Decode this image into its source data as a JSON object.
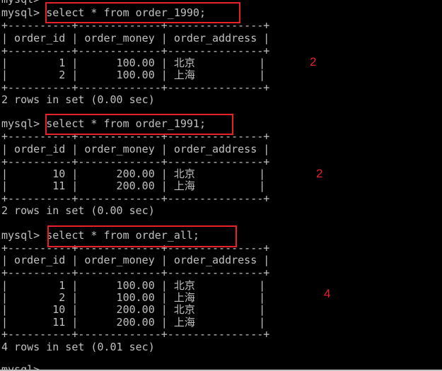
{
  "terminal": {
    "top_partial": "mysql>",
    "bottom_partial": "mysql>",
    "blocks": [
      {
        "prompt": "mysql> ",
        "command": "select * from order_1990;",
        "border": "+----------+-------------+---------------+",
        "header": "| order_id | order_money | order_address |",
        "rows": [
          "|        1 |      100.00 | 北京          |",
          "|        2 |      100.00 | 上海          |"
        ],
        "result": "2 rows in set (0.00 sec)",
        "annotation": "2"
      },
      {
        "prompt": "mysql> ",
        "command": "select * from order_1991;",
        "border": "+----------+-------------+---------------+",
        "header": "| order_id | order_money | order_address |",
        "rows": [
          "|       10 |      200.00 | 北京          |",
          "|       11 |      200.00 | 上海          |"
        ],
        "result": "2 rows in set (0.00 sec)",
        "annotation": "2"
      },
      {
        "prompt": "mysql> ",
        "command": "select * from order_all;",
        "border": "+----------+-------------+---------------+",
        "header": "| order_id | order_money | order_address |",
        "rows": [
          "|        1 |      100.00 | 北京          |",
          "|        2 |      100.00 | 上海          |",
          "|       10 |      200.00 | 北京          |",
          "|       11 |      200.00 | 上海          |"
        ],
        "result": "4 rows in set (0.01 sec)",
        "annotation": "4"
      }
    ]
  },
  "colors": {
    "background": "#000000",
    "text": "#c0c0c0",
    "highlight": "#e8202a"
  }
}
